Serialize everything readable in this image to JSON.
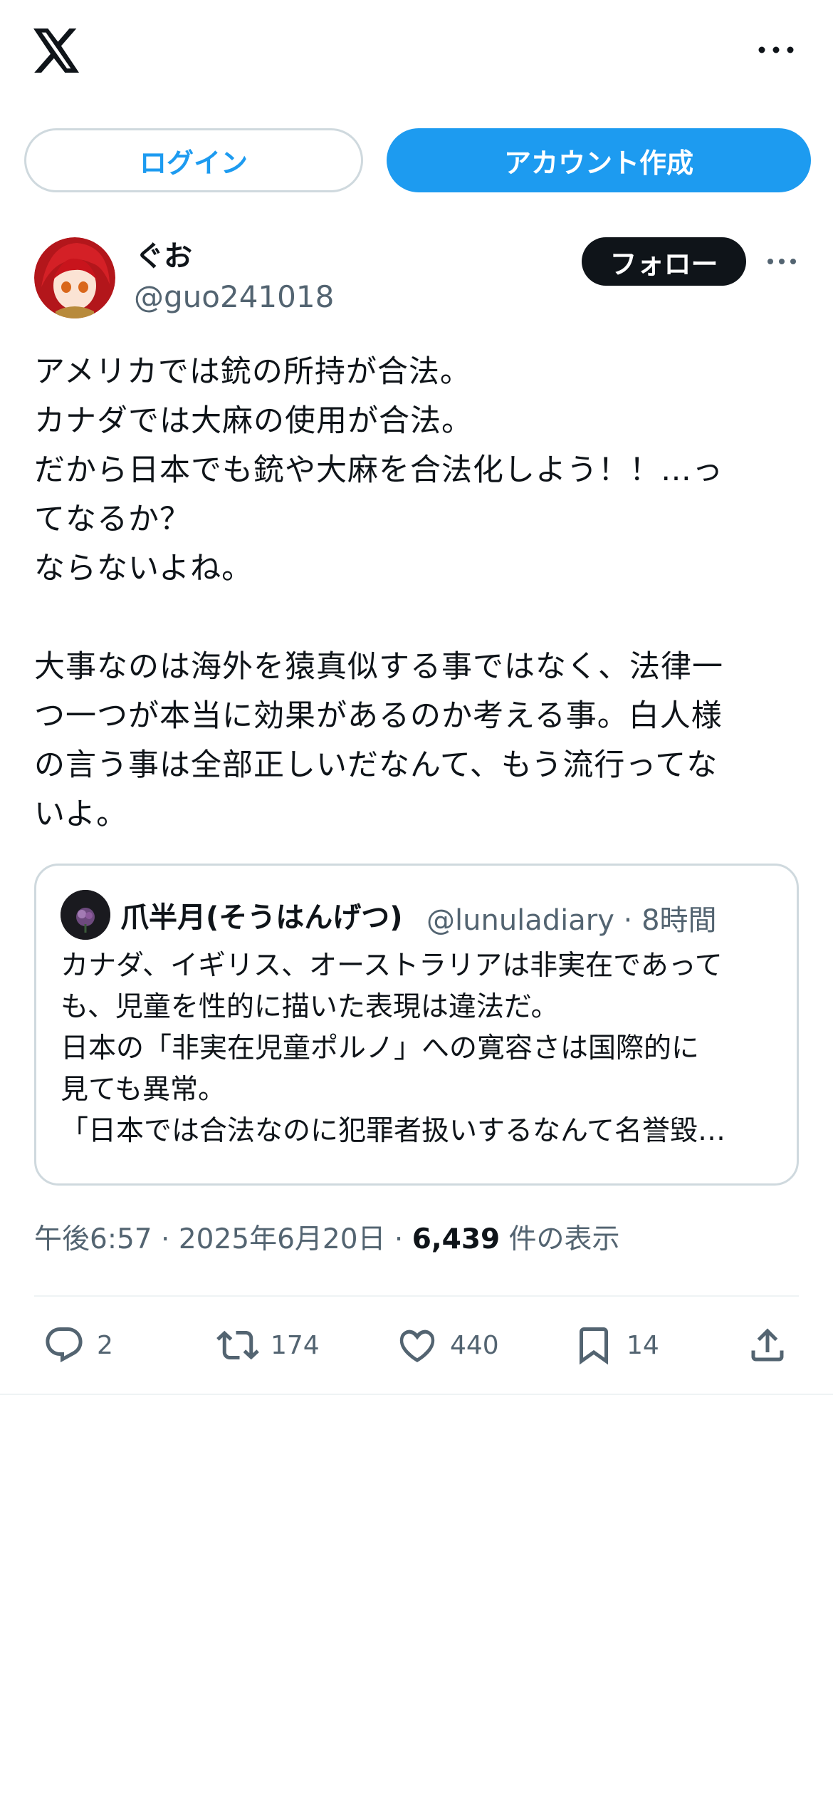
{
  "header": {
    "logo_icon": "x-logo-icon",
    "more_icon": "more-horizontal-icon"
  },
  "auth": {
    "login_label": "ログイン",
    "signup_label": "アカウント作成"
  },
  "post": {
    "display_name": "ぐお",
    "handle": "@guo241018",
    "follow_label": "フォロー",
    "text": "アメリカでは銃の所持が合法。\nカナダでは大麻の使用が合法。\nだから日本でも銃や大麻を合法化しよう！！…っ\nてなるか？\nならないよね。\n\n大事なのは海外を猿真似する事ではなく、法律一\nつ一つが本当に効果があるのか考える事。白人様\nの言う事は全部正しいだなんて、もう流行ってな\nいよ。"
  },
  "quote": {
    "display_name": "爪半月(そうはんげつ)",
    "handle": "@lunuladiary",
    "separator": "·",
    "time": "8時間",
    "lines": [
      "カナダ、イギリス、オーストラリアは非実在であって",
      "も、児童を性的に描いた表現は違法だ。",
      "日本の「非実在児童ポルノ」への寛容さは国際的に",
      "見ても異常。",
      "「日本では合法なのに犯罪者扱いするなんて名誉毀…"
    ]
  },
  "meta": {
    "time": "午後6:57",
    "separator": "·",
    "date": "2025年6月20日",
    "views": "6,439",
    "views_label": "件の表示"
  },
  "actions": {
    "replies": "2",
    "retweets": "174",
    "likes": "440",
    "bookmarks": "14"
  },
  "colors": {
    "accent": "#1d9bf0",
    "text": "#0f1419",
    "muted": "#536471",
    "border": "#cfd9de"
  }
}
